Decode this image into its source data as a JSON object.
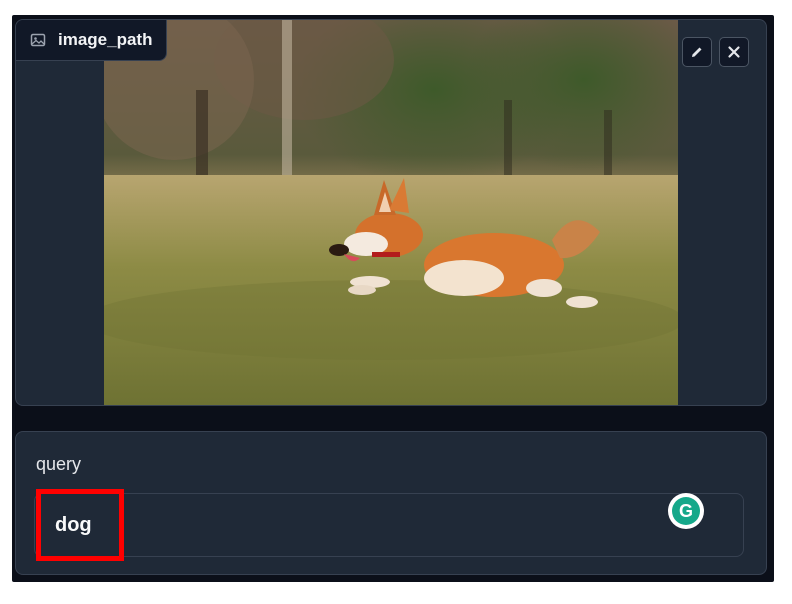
{
  "image_component": {
    "label": "image_path",
    "label_icon": "image-icon",
    "edit_icon": "pencil-icon",
    "clear_icon": "close-icon",
    "image_alt": "corgi running on grass"
  },
  "query_component": {
    "label": "query",
    "value": "dog"
  },
  "grammarly": {
    "icon": "grammarly-icon",
    "letter": "G"
  },
  "colors": {
    "panel_bg": "#1f2937",
    "app_bg": "#0b0f19",
    "highlight": "#ff0000",
    "grammarly_green": "#15a88a"
  }
}
